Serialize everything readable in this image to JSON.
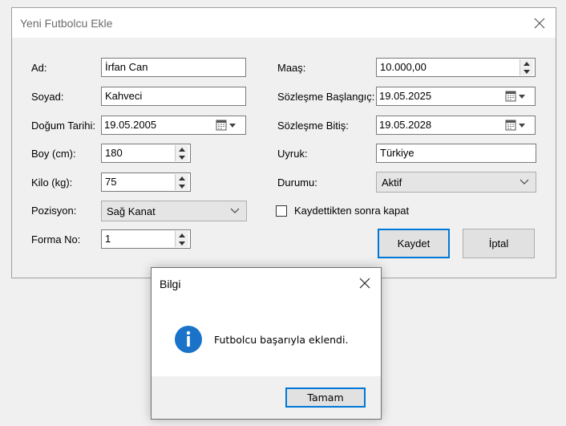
{
  "main_window": {
    "title": "Yeni Futbolcu Ekle",
    "fields": {
      "ad": {
        "label": "Ad:",
        "value": "İrfan Can"
      },
      "soyad": {
        "label": "Soyad:",
        "value": "Kahveci"
      },
      "dogum_tarihi": {
        "label": "Doğum Tarihi:",
        "value": "19.05.2005"
      },
      "boy": {
        "label": "Boy (cm):",
        "value": "180"
      },
      "kilo": {
        "label": "Kilo (kg):",
        "value": "75"
      },
      "pozisyon": {
        "label": "Pozisyon:",
        "value": "Sağ Kanat"
      },
      "forma_no": {
        "label": "Forma No:",
        "value": "1"
      },
      "maas": {
        "label": "Maaş:",
        "value": "10.000,00"
      },
      "sozlesme_baslangic": {
        "label": "Sözleşme Başlangıç:",
        "value": "19.05.2025"
      },
      "sozlesme_bitis": {
        "label": "Sözleşme Bitiş:",
        "value": "19.05.2028"
      },
      "uyruk": {
        "label": "Uyruk:",
        "value": "Türkiye"
      },
      "durumu": {
        "label": "Durumu:",
        "value": "Aktif"
      }
    },
    "checkbox_label": "Kaydettikten sonra kapat",
    "checkbox_checked": false,
    "save_label": "Kaydet",
    "cancel_label": "İptal"
  },
  "dialog": {
    "title": "Bilgi",
    "message": "Futbolcu başarıyla eklendi.",
    "ok_label": "Tamam",
    "icon": "info-icon"
  },
  "colors": {
    "accent": "#0078d7",
    "window_bg": "#f0f0f0"
  }
}
